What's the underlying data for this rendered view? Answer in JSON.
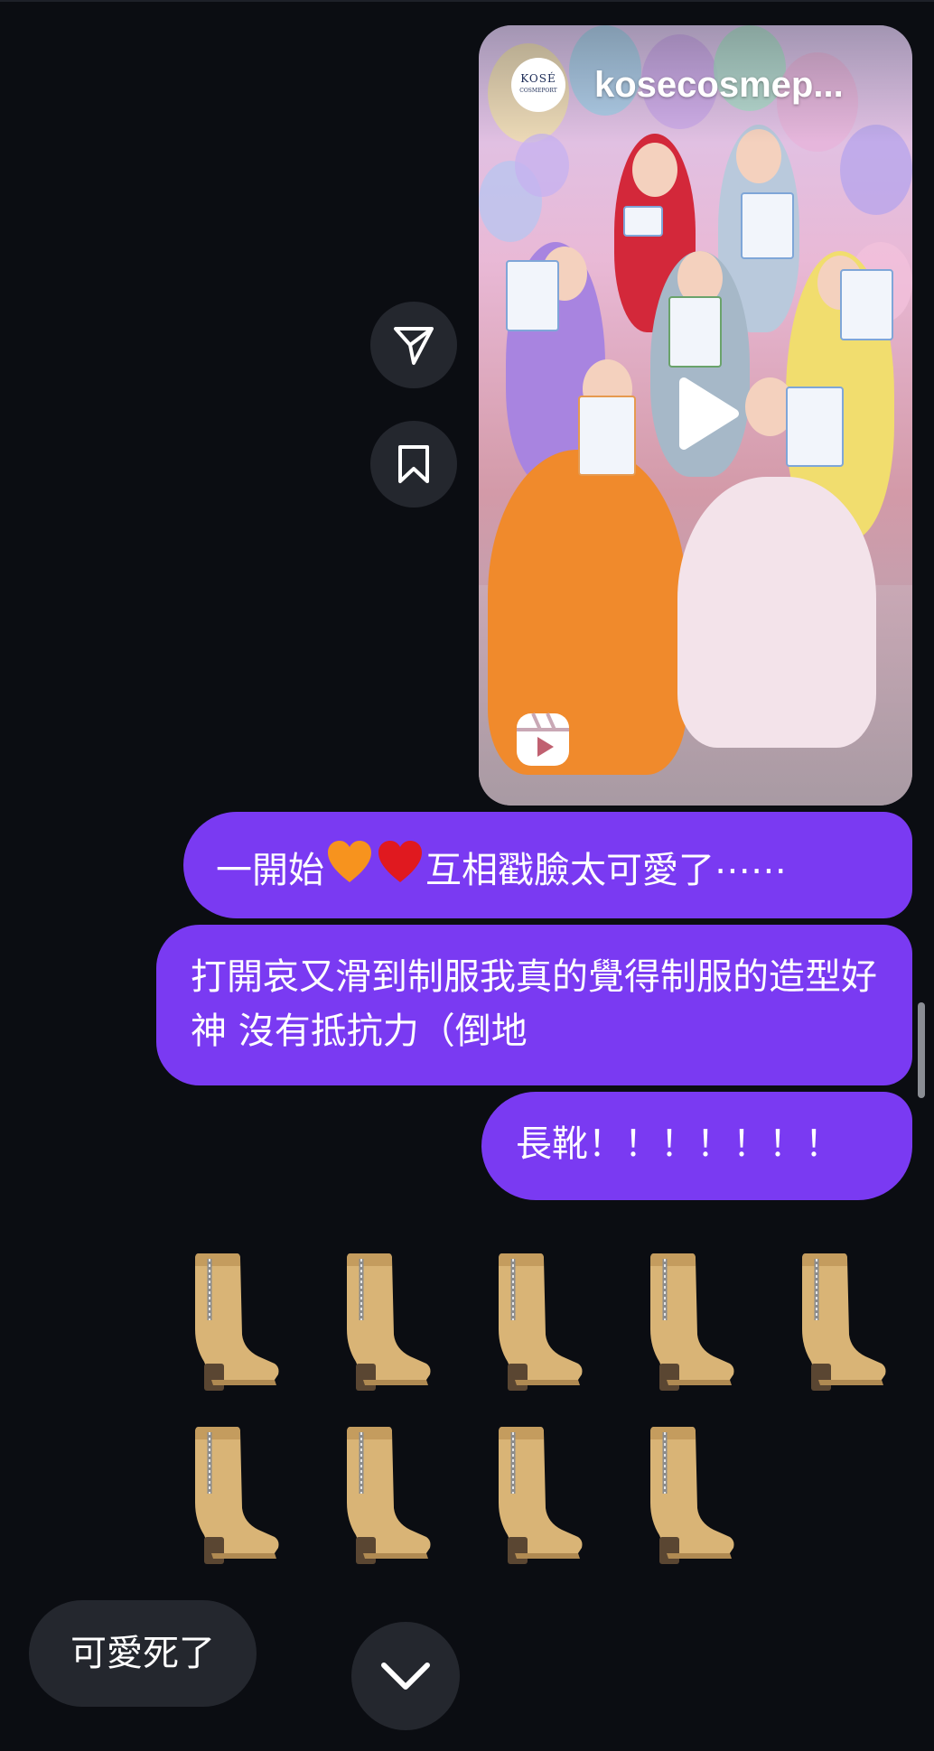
{
  "reel": {
    "account_name": "kosecosmep...",
    "avatar_text_top": "KOSÉ",
    "avatar_text_bottom": "COSMEPORT"
  },
  "messages": {
    "sent_1_before": "一開始",
    "sent_1_after": "互相戳臉太可愛了⋯⋯",
    "sent_2": "打開哀又滑到制服我真的覺得制服的造型好神 沒有抵抗力（倒地",
    "sent_3": "長靴！！！！！！！",
    "boot_count": 9,
    "received_1": "可愛死了"
  },
  "colors": {
    "background": "#0b0d12",
    "sent_bubble": "#7a3af2",
    "received_bubble": "#24272e",
    "button_bg": "#24272e"
  },
  "icons": {
    "share": "paper-plane-icon",
    "save": "bookmark-icon",
    "play": "play-icon",
    "reels": "reels-icon",
    "scroll_down": "chevron-down-icon",
    "emoji_1": "orange-heart-emoji",
    "emoji_2": "red-heart-emoji",
    "boot": "womans-boot-emoji"
  }
}
